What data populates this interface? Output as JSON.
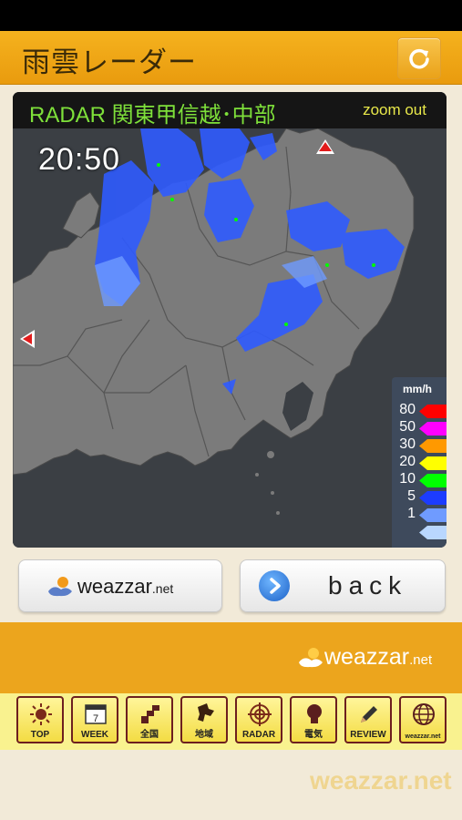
{
  "header": {
    "title": "雨雲レーダー",
    "reload_icon": "reload-icon"
  },
  "radar": {
    "title": "RADAR 関東甲信越･中部",
    "zoom_label": "zoom out",
    "time": "20:50",
    "legend_unit": "mm/h",
    "legend": [
      {
        "label": "80",
        "color": "#ff0000"
      },
      {
        "label": "50",
        "color": "#ff00ff"
      },
      {
        "label": "30",
        "color": "#ff9900"
      },
      {
        "label": "20",
        "color": "#ffff00"
      },
      {
        "label": "10",
        "color": "#00ff00"
      },
      {
        "label": "5",
        "color": "#1c3cff"
      },
      {
        "label": "1",
        "color": "#6f9bff"
      },
      {
        "label": "",
        "color": "#b9d7ff"
      }
    ]
  },
  "buttons": {
    "weazzar_label": "weazzar",
    "weazzar_suffix": ".net",
    "back_label": "back"
  },
  "banner": {
    "logo_text": "weazzar",
    "logo_suffix": ".net"
  },
  "nav": [
    {
      "label": "TOP",
      "icon": "sun-icon"
    },
    {
      "label": "WEEK",
      "icon": "calendar-icon"
    },
    {
      "label": "全国",
      "icon": "nationwide-icon"
    },
    {
      "label": "地域",
      "icon": "region-icon"
    },
    {
      "label": "RADAR",
      "icon": "radar-icon"
    },
    {
      "label": "電気",
      "icon": "lightbulb-icon"
    },
    {
      "label": "REVIEW",
      "icon": "pencil-icon"
    },
    {
      "label": "weazzar.net",
      "icon": "globe-icon"
    }
  ],
  "nav_week_day": "7",
  "footer": {
    "logo": "weazzar.net"
  },
  "colors": {
    "header": "#eca51d",
    "map_land": "#7b7b7b",
    "map_sea": "#3b3f44",
    "rain": "#2f5bff"
  }
}
